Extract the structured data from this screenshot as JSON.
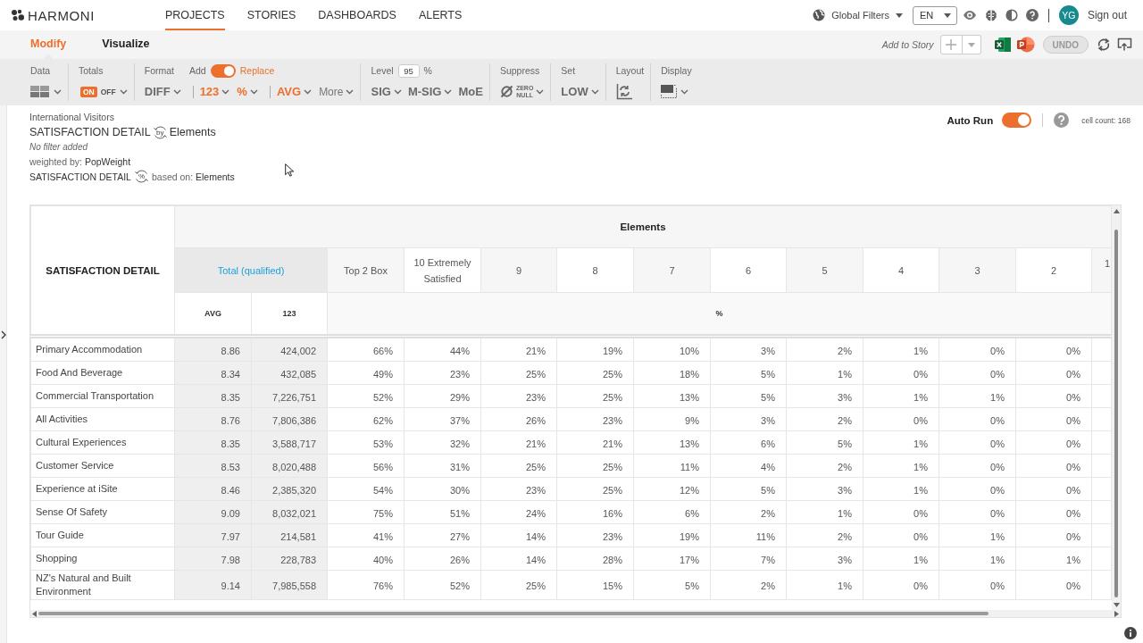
{
  "brand": {
    "name": "HARMONI"
  },
  "nav": [
    {
      "label": "PROJECTS",
      "selected": true
    },
    {
      "label": "STORIES",
      "selected": false
    },
    {
      "label": "DASHBOARDS",
      "selected": false
    },
    {
      "label": "ALERTS",
      "selected": false
    }
  ],
  "header_tools": {
    "global_filters": "Global Filters",
    "language": "EN",
    "user_initials": "YG",
    "sign_out": "Sign out"
  },
  "mode_tabs": [
    {
      "label": "Modify",
      "selected": true
    },
    {
      "label": "Visualize",
      "selected": false
    }
  ],
  "story_actions": {
    "add_to_story": "Add to Story",
    "undo": {
      "label": "UNDO",
      "disabled": true
    }
  },
  "toolbar": [
    {
      "kind": "data",
      "label": "Data"
    },
    {
      "kind": "totals",
      "label": "Totals",
      "on": true,
      "on_text": "ON",
      "off_text": "OFF"
    },
    {
      "kind": "format",
      "label": "Format",
      "add_label": "Add",
      "replace_label": "Replace",
      "replace": true,
      "option_groups": [
        [
          {
            "label": "DIFF",
            "kind": "menu",
            "active": false
          }
        ],
        [
          {
            "label": "123",
            "kind": "menu",
            "active": true
          },
          {
            "label": "%",
            "kind": "menu",
            "active": true
          }
        ],
        [
          {
            "label": "AVG",
            "kind": "menu",
            "active": true
          },
          {
            "label": "More",
            "kind": "more",
            "active": false
          }
        ]
      ]
    },
    {
      "kind": "level",
      "label": "Level",
      "value": "95",
      "unit": "%",
      "options": [
        {
          "label": "SIG",
          "kind": "menu"
        },
        {
          "label": "M-SIG",
          "kind": "menu"
        },
        {
          "label": "MoE",
          "kind": "plain"
        }
      ]
    },
    {
      "kind": "suppress",
      "label": "Suppress",
      "zero_text": "ZERO",
      "null_text": "NULL"
    },
    {
      "kind": "set",
      "label": "Set",
      "value": "LOW"
    },
    {
      "kind": "layout",
      "label": "Layout"
    },
    {
      "kind": "display",
      "label": "Display"
    }
  ],
  "report": {
    "dataset": "International Visitors",
    "title": "SATISFACTION DETAIL",
    "by_icon_text": "by",
    "by": "Elements",
    "filter": "No filter added",
    "weighted_label": "weighted by:",
    "weight": "PopWeight",
    "base_title": "SATISFACTION DETAIL",
    "percent_icon_text": "%",
    "based_label": "based on:",
    "base": "Elements"
  },
  "run_panel": {
    "auto_run": {
      "label": "Auto Run",
      "on": true
    },
    "cell_count": "cell count: 168"
  },
  "table": {
    "corner": "SATISFACTION DETAIL",
    "banner": "Elements",
    "total": {
      "label": "Total (qualified)",
      "measures": [
        "AVG",
        "123"
      ]
    },
    "columns": [
      "Top 2 Box",
      "10 Extremely Satisfied",
      "9",
      "8",
      "7",
      "6",
      "5",
      "4",
      "3",
      "2",
      "1"
    ],
    "column_measure": "%",
    "rows": [
      {
        "label": "Primary Accommodation",
        "avg": "8.86",
        "count": "424,002",
        "values": [
          "66%",
          "44%",
          "21%",
          "19%",
          "10%",
          "3%",
          "2%",
          "1%",
          "0%",
          "0%"
        ]
      },
      {
        "label": "Food And Beverage",
        "avg": "8.34",
        "count": "432,085",
        "values": [
          "49%",
          "23%",
          "25%",
          "25%",
          "18%",
          "5%",
          "1%",
          "0%",
          "0%",
          "0%"
        ]
      },
      {
        "label": "Commercial Transportation",
        "avg": "8.35",
        "count": "7,226,751",
        "values": [
          "52%",
          "29%",
          "23%",
          "25%",
          "13%",
          "5%",
          "3%",
          "1%",
          "1%",
          "0%"
        ]
      },
      {
        "label": "All Activities",
        "avg": "8.76",
        "count": "7,806,386",
        "values": [
          "62%",
          "37%",
          "26%",
          "23%",
          "9%",
          "3%",
          "2%",
          "0%",
          "0%",
          "0%"
        ]
      },
      {
        "label": "Cultural Experiences",
        "avg": "8.35",
        "count": "3,588,717",
        "values": [
          "53%",
          "32%",
          "21%",
          "21%",
          "13%",
          "6%",
          "5%",
          "1%",
          "0%",
          "0%"
        ]
      },
      {
        "label": "Customer Service",
        "avg": "8.53",
        "count": "8,020,488",
        "values": [
          "56%",
          "31%",
          "25%",
          "25%",
          "11%",
          "4%",
          "2%",
          "1%",
          "0%",
          "0%"
        ]
      },
      {
        "label": "Experience at iSite",
        "avg": "8.46",
        "count": "2,385,320",
        "values": [
          "54%",
          "30%",
          "23%",
          "25%",
          "12%",
          "5%",
          "3%",
          "1%",
          "0%",
          "0%"
        ]
      },
      {
        "label": "Sense Of Safety",
        "avg": "9.09",
        "count": "8,032,021",
        "values": [
          "75%",
          "51%",
          "24%",
          "16%",
          "6%",
          "2%",
          "1%",
          "0%",
          "0%",
          "0%"
        ]
      },
      {
        "label": "Tour Guide",
        "avg": "7.97",
        "count": "214,581",
        "values": [
          "41%",
          "27%",
          "14%",
          "23%",
          "19%",
          "11%",
          "2%",
          "0%",
          "1%",
          "0%"
        ]
      },
      {
        "label": "Shopping",
        "avg": "7.98",
        "count": "228,783",
        "values": [
          "40%",
          "26%",
          "14%",
          "28%",
          "17%",
          "7%",
          "3%",
          "1%",
          "1%",
          "1%"
        ]
      },
      {
        "label": "NZ's Natural and Built Environment",
        "avg": "9.14",
        "count": "7,985,558",
        "values": [
          "76%",
          "52%",
          "25%",
          "15%",
          "5%",
          "2%",
          "1%",
          "0%",
          "0%",
          "0%"
        ]
      }
    ]
  }
}
